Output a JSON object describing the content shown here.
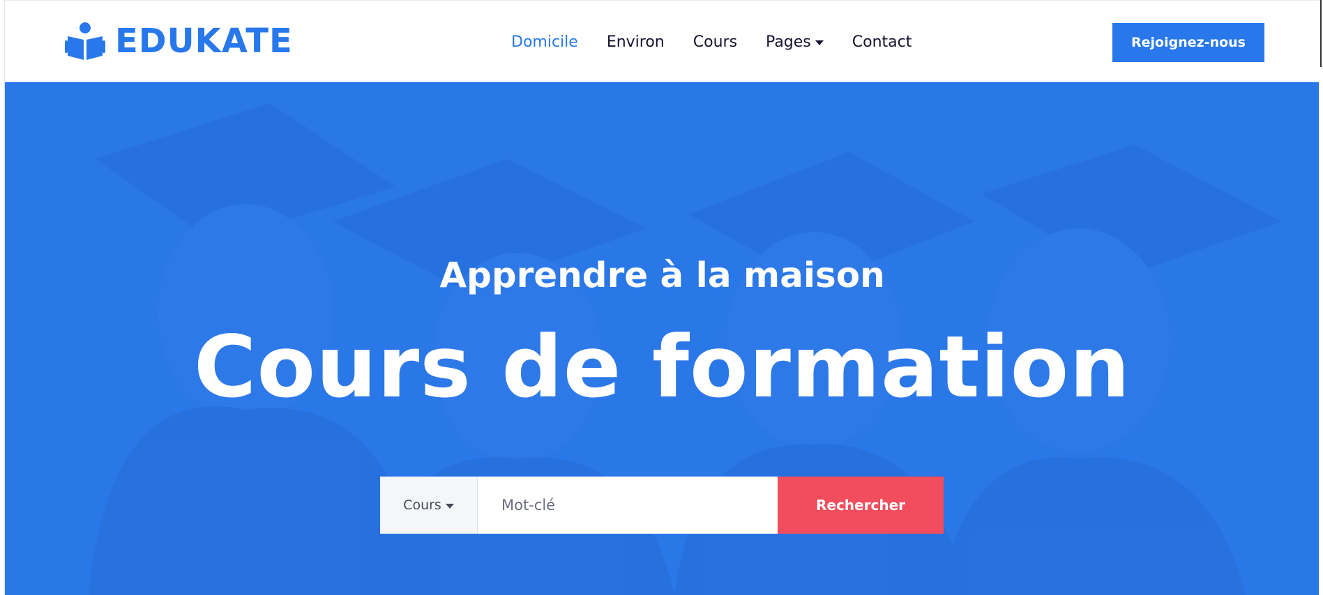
{
  "brand": {
    "name": "EDUKATE",
    "icon": "book-reader-icon",
    "color": "#2878eb"
  },
  "nav": {
    "items": [
      {
        "label": "Domicile",
        "active": true
      },
      {
        "label": "Environ",
        "active": false
      },
      {
        "label": "Cours",
        "active": false
      },
      {
        "label": "Pages",
        "active": false,
        "dropdown": true
      },
      {
        "label": "Contact",
        "active": false
      }
    ],
    "cta_label": "Rejoignez-nous"
  },
  "hero": {
    "subtitle": "Apprendre à la maison",
    "title": "Cours de formation",
    "overlay_color": "#2a77e8",
    "background": "graduates-photo"
  },
  "search": {
    "category_selected": "Cours",
    "keyword_placeholder": "Mot-clé",
    "keyword_value": "",
    "button_label": "Rechercher",
    "button_color": "#f14d5d"
  }
}
